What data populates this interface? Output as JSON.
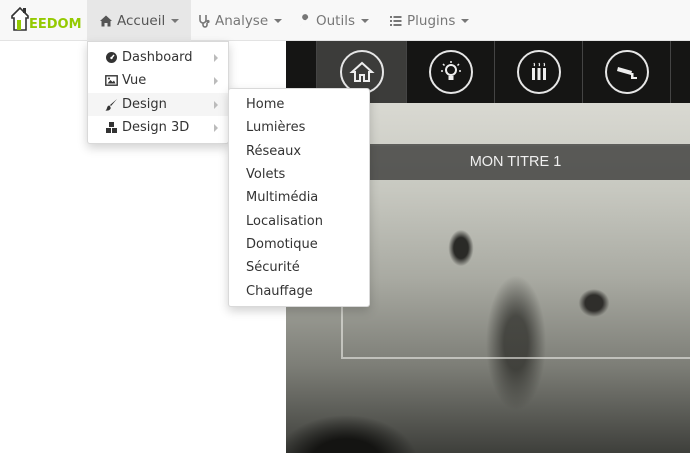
{
  "logo": {
    "text": "EEDOM",
    "color": "#94ca02"
  },
  "navbar": {
    "items": [
      {
        "label": "Accueil",
        "icon": "home-icon"
      },
      {
        "label": "Analyse",
        "icon": "stethoscope-icon"
      },
      {
        "label": "Outils",
        "icon": "wrench-icon"
      },
      {
        "label": "Plugins",
        "icon": "list-icon"
      }
    ]
  },
  "menu": {
    "items": [
      {
        "label": "Dashboard",
        "icon": "dashboard-icon"
      },
      {
        "label": "Vue",
        "icon": "picture-icon"
      },
      {
        "label": "Design",
        "icon": "paintbrush-icon"
      },
      {
        "label": "Design 3D",
        "icon": "cubes-icon"
      }
    ]
  },
  "submenu": {
    "items": [
      "Home",
      "Lumières",
      "Réseaux",
      "Volets",
      "Multimédia",
      "Localisation",
      "Domotique",
      "Sécurité",
      "Chauffage"
    ]
  },
  "design": {
    "panel_title": "MON TITRE 1",
    "icons": [
      "house-icon",
      "lightbulb-icon",
      "radiator-icon",
      "camera-icon"
    ]
  }
}
